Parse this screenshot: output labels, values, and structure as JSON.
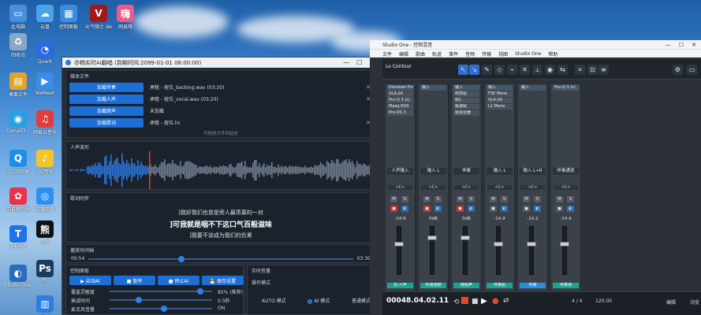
{
  "desktop_icons": [
    {
      "label": "此电脑",
      "color": "#4a90d9",
      "glyph": "▭"
    },
    {
      "label": "回收站",
      "color": "#8aa6c3",
      "glyph": "♻"
    },
    {
      "label": "桌面文件",
      "color": "#e0a42b",
      "glyph": "▤"
    },
    {
      "label": "Compil3...",
      "color": "#2aa0e0",
      "glyph": "◉"
    },
    {
      "label": "QQ浏览器",
      "color": "#1f8ee8",
      "glyph": "Q"
    },
    {
      "label": "向日葵远程",
      "color": "#e8334a",
      "glyph": "✿"
    },
    {
      "label": "ToDesk",
      "color": "#1c74e8",
      "glyph": "T"
    },
    {
      "label": "Studio One 7",
      "color": "#2b6cb8",
      "glyph": "◐"
    },
    {
      "label": "云盘",
      "color": "#4aa3e8",
      "glyph": "☁"
    },
    {
      "label": "Quark",
      "color": "#2a69e0",
      "glyph": "◔"
    },
    {
      "label": "WeMeet",
      "color": "#3a8ee8",
      "glyph": "▶"
    },
    {
      "label": "网易云音乐",
      "color": "#e23d3d",
      "glyph": "♫"
    },
    {
      "label": "QQ音乐",
      "color": "#f3c42b",
      "glyph": "♪"
    },
    {
      "label": "百度网盘",
      "color": "#2e8ff2",
      "glyph": "◎"
    },
    {
      "label": "小贝",
      "color": "#111111",
      "glyph": "熊"
    },
    {
      "label": "PS",
      "color": "#1b3a5c",
      "glyph": "Ps"
    },
    {
      "label": "网络",
      "color": "#2b7de0",
      "glyph": "▥"
    },
    {
      "label": "控制面板",
      "color": "#3b8de0",
      "glyph": "▦"
    },
    {
      "label": "元气骑士 WeGame",
      "color": "#a01818",
      "glyph": "V"
    },
    {
      "label": "网易嗨",
      "color": "#e85a8a",
      "glyph": "嗨"
    }
  ],
  "translator": {
    "title": "亦畅实时AI翻唱 (到期时间:2099-01-01 08:00:00)",
    "sec_files": "媒体文件",
    "files": [
      {
        "btn": "加载伴奏",
        "text": "承租 - 痘位_backing.wav (03:20)"
      },
      {
        "btn": "加载人声",
        "text": "承租 - 痘位_vocal.wav (03:20)"
      },
      {
        "btn": "加载原声",
        "text": "未加载"
      },
      {
        "btn": "加载歌词",
        "text": "承租 - 痘位.lrc"
      }
    ],
    "drop_hint": "可拖放文件到此处",
    "sec_wave": "人声波形",
    "sec_lyrics": "歌词同步",
    "lyric_prev": "]我好我们也曾是旁人最羡慕的一对",
    "lyric_cur": "]可我就是咽不下这口气百般滋味",
    "lyric_next": "]我要不该成为我们的负累",
    "sec_timeline": "播放时间轴",
    "time_cur": "00:54",
    "time_total": "03:30",
    "progress": 0.34,
    "sec_controls": "控制面板",
    "controls": [
      "▶ 启动AI",
      "■ 暂停",
      "■ 停止AI",
      "💾 保存设置"
    ],
    "sec_volume": "实时音量",
    "sec_mode": "操作模式",
    "modes": [
      "AUTO 模式",
      "AI 模式",
      "普通模式"
    ],
    "selected_mode": "AI 模式",
    "params": [
      {
        "label": "覆盖灵敏度",
        "value": "85%  (推荐)",
        "level": 0.85
      },
      {
        "label": "衰减时间",
        "value": "0.5秒",
        "level": 0.25
      },
      {
        "label": "麦克风音量",
        "value": "ON",
        "level": 0.5
      }
    ]
  },
  "studio": {
    "title": "Studio One - 控制混音",
    "menu": [
      "文件",
      "编辑",
      "歌曲",
      "轨道",
      "事件",
      "音频",
      "传输",
      "视图",
      "Studio One",
      "帮助"
    ],
    "device": "Lo Contour",
    "transport_time": "00048.04.02.11",
    "tempo": "120.00",
    "signature": "4 / 4",
    "edit_btn": "编辑",
    "browse_btn": "浏览",
    "channels": [
      {
        "name": "人声输入",
        "inserts": [
          "Denoiser Pro",
          "VLA-2A",
          "Pro-Q 3 (s)",
          "Maag EQ4",
          "Pro-DS 3"
        ],
        "vol": "-14.9",
        "bottom": "原·人声",
        "color": "#1aa58f"
      },
      {
        "name": "输入 L",
        "inserts": [
          "输入"
        ],
        "vol": "0dB",
        "bottom": "中通道链",
        "color": "#1aa58f"
      },
      {
        "name": "伴奏",
        "inserts": [
          "输入",
          "响亮组",
          "组1",
          "极速组",
          "组混合器"
        ],
        "vol": "0dB",
        "bottom": "链组声",
        "color": "#1aa58f"
      },
      {
        "name": "输入 L",
        "inserts": [
          "输入",
          "FSE Mono",
          "VLA-2A",
          "L2 Mono"
        ],
        "vol": "-14.9",
        "bottom": "伴奏组",
        "color": "#1aa58f"
      },
      {
        "name": "输入 L+R",
        "inserts": [
          "输入"
        ],
        "vol": "-14.2",
        "bottom": "伴奏",
        "color": "#2a8ee0"
      },
      {
        "name": "伴奏通道",
        "inserts": [
          "Pro-Q 3 (s)"
        ],
        "vol": "-14.4",
        "bottom": "伴奏通",
        "color": "#1aa58f"
      }
    ]
  }
}
